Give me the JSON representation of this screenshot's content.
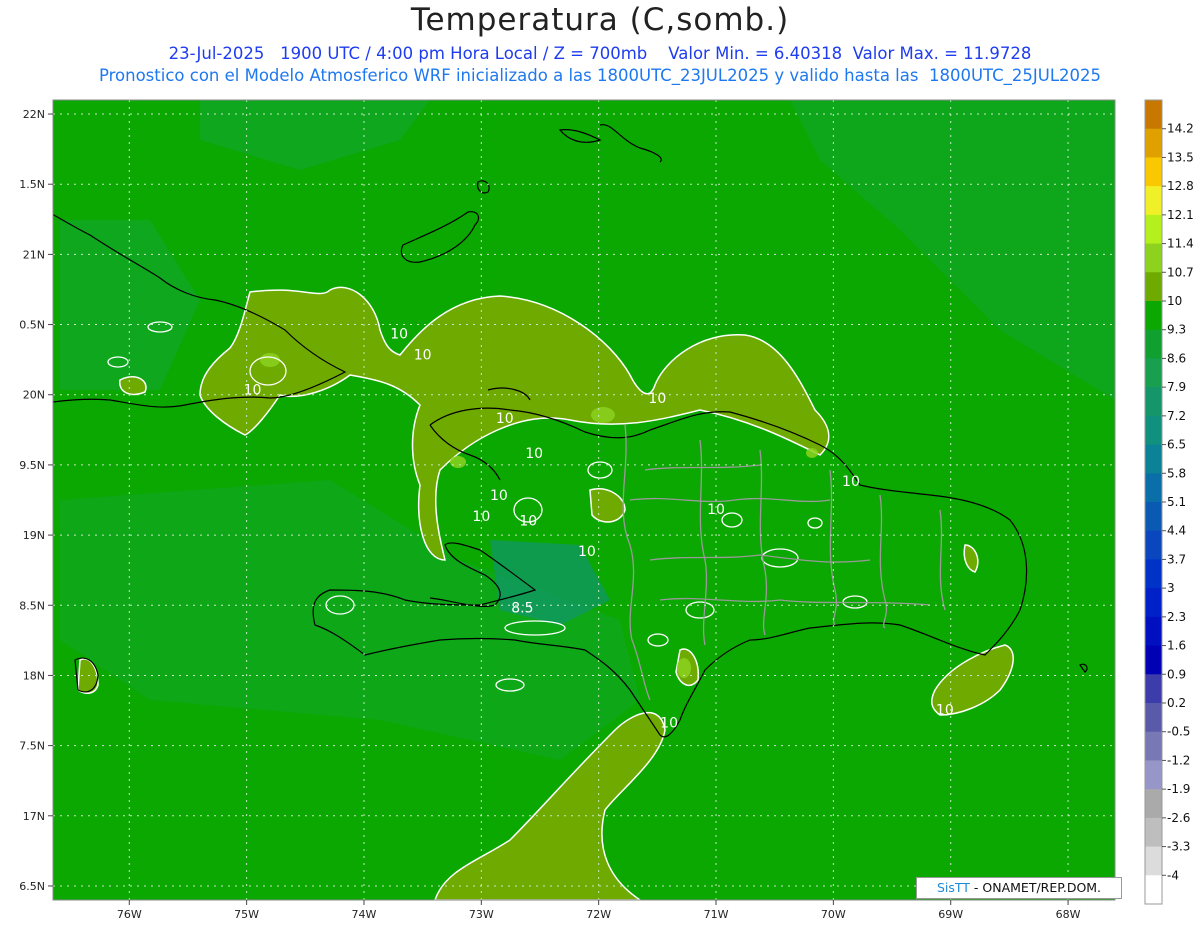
{
  "header": {
    "title": "Temperatura (C,somb.)",
    "subtitle1": "23-Jul-2025   1900 UTC / 4:00 pm Hora Local / Z = 700mb    Valor Min. = 6.40318  Valor Max. = 11.9728",
    "subtitle2": "Pronostico con el Modelo Atmosferico WRF inicializado a las 1800UTC_23JUL2025 y valido hasta las  1800UTC_25JUL2025"
  },
  "map": {
    "lon_range": [
      -76.65,
      -67.6
    ],
    "lat_range": [
      16.4,
      22.1
    ],
    "lat_ticks": [
      "22N",
      "1.5N",
      "21N",
      "0.5N",
      "20N",
      "9.5N",
      "19N",
      "8.5N",
      "18N",
      "7.5N",
      "17N",
      "6.5N"
    ],
    "lon_ticks": [
      "76W",
      "75W",
      "74W",
      "73W",
      "72W",
      "71W",
      "70W",
      "69W",
      "68W"
    ],
    "background_color": "#0aa800",
    "contour_labels": [
      "10",
      "10",
      "10",
      "10",
      "10",
      "10",
      "10",
      "10",
      "10",
      "10",
      "10",
      "10",
      "8.5",
      "10",
      "10"
    ]
  },
  "colorbar": {
    "levels": [
      "14.2",
      "13.5",
      "12.8",
      "12.1",
      "11.4",
      "10.7",
      "10",
      "9.3",
      "8.6",
      "7.9",
      "7.2",
      "6.5",
      "5.8",
      "5.1",
      "4.4",
      "3.7",
      "3",
      "2.3",
      "1.6",
      "0.9",
      "0.2",
      "-0.5",
      "-1.2",
      "-1.9",
      "-2.6",
      "-3.3",
      "-4"
    ],
    "colors": [
      "#c87800",
      "#e0a000",
      "#fac800",
      "#f0f028",
      "#b4f01e",
      "#8cd21e",
      "#6eaa00",
      "#0aa800",
      "#10a030",
      "#18a050",
      "#14966a",
      "#10907e",
      "#0c8296",
      "#0a6ea8",
      "#0a5ab4",
      "#0a46be",
      "#0032c8",
      "#0020c8",
      "#0010c0",
      "#0000b4",
      "#3c3caa",
      "#5a5aaa",
      "#7878b4",
      "#9696c8",
      "#aaaaaa",
      "#bebebe",
      "#dcdcdc",
      "#ffffff"
    ]
  },
  "credit": {
    "brand": "SisTT",
    "text": " - ONAMET/REP.DOM."
  }
}
